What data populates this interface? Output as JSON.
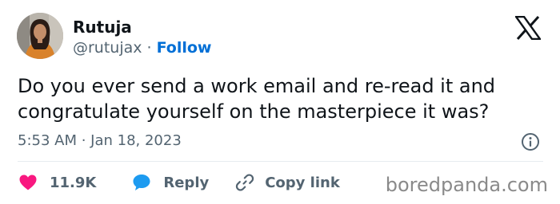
{
  "author": {
    "display_name": "Rutuja",
    "handle": "@rutujax",
    "separator": "·",
    "follow_label": "Follow"
  },
  "tweet": {
    "text": "Do you ever send a work email and re-read it and congratulate yourself on the masterpiece it was?",
    "timestamp": "5:53 AM · Jan 18, 2023"
  },
  "actions": {
    "likes_count": "11.9K",
    "reply_label": "Reply",
    "copy_link_label": "Copy link"
  },
  "icons": {
    "platform_logo": "x-logo-icon",
    "info": "info-icon",
    "like": "heart-icon",
    "reply": "speech-bubble-icon",
    "copy_link": "link-icon"
  },
  "colors": {
    "text_primary": "#0f1419",
    "text_secondary": "#536471",
    "follow": "#006fd6",
    "like": "#f91880",
    "reply": "#1d9bf0",
    "watermark": "#8a8a8a"
  },
  "watermark": "boredpanda.com"
}
